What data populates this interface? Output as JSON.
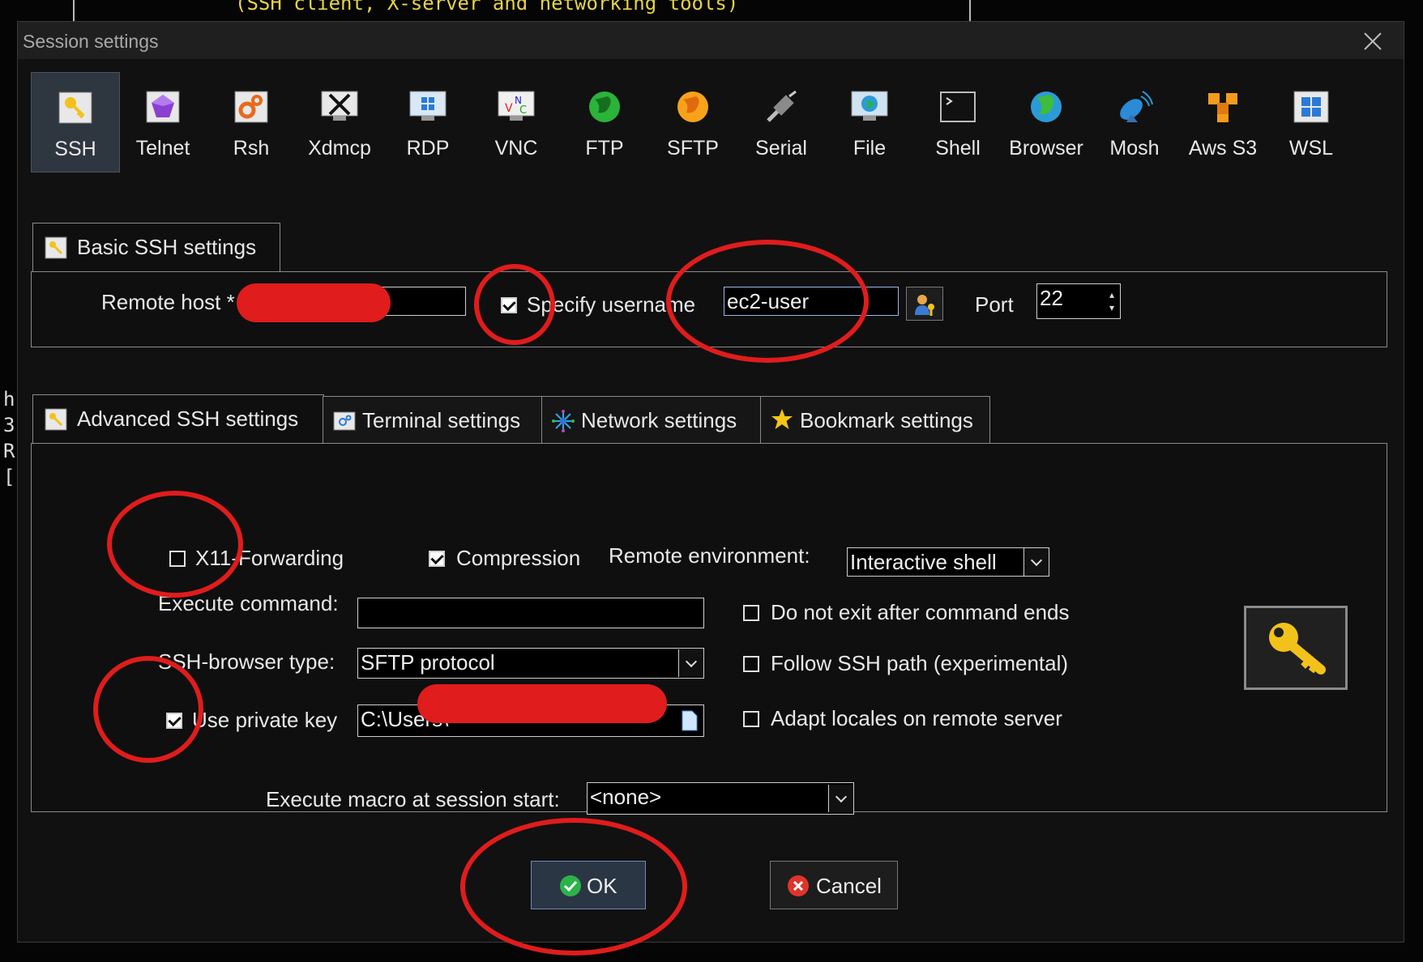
{
  "background": {
    "caption": "(SSH client, X-server and networking tools)",
    "left_chars": [
      "h",
      "3",
      "R",
      "["
    ]
  },
  "dialog": {
    "title": "Session settings"
  },
  "session_types": [
    {
      "label": "SSH",
      "icon": "key-icon",
      "active": true
    },
    {
      "label": "Telnet",
      "icon": "gem-icon"
    },
    {
      "label": "Rsh",
      "icon": "gears-icon"
    },
    {
      "label": "Xdmcp",
      "icon": "x-monitor-icon"
    },
    {
      "label": "RDP",
      "icon": "windows-monitor-icon"
    },
    {
      "label": "VNC",
      "icon": "vnc-monitor-icon"
    },
    {
      "label": "FTP",
      "icon": "green-globe-icon"
    },
    {
      "label": "SFTP",
      "icon": "orange-globe-icon"
    },
    {
      "label": "Serial",
      "icon": "serial-plug-icon"
    },
    {
      "label": "File",
      "icon": "file-monitor-icon"
    },
    {
      "label": "Shell",
      "icon": "terminal-icon"
    },
    {
      "label": "Browser",
      "icon": "globe-icon"
    },
    {
      "label": "Mosh",
      "icon": "satellite-dish-icon"
    },
    {
      "label": "Aws S3",
      "icon": "aws-cubes-icon"
    },
    {
      "label": "WSL",
      "icon": "windows-logo-icon"
    }
  ],
  "basic": {
    "tab_label": "Basic SSH settings",
    "remote_host_label": "Remote host *",
    "remote_host_value": "",
    "specify_username_label": "Specify username",
    "specify_username_checked": true,
    "username_value": "ec2-user",
    "port_label": "Port",
    "port_value": "22"
  },
  "tabs": [
    {
      "label": "Advanced SSH settings",
      "icon": "key-icon",
      "active": true
    },
    {
      "label": "Terminal settings",
      "icon": "terminal-gear-icon"
    },
    {
      "label": "Network settings",
      "icon": "network-star-icon"
    },
    {
      "label": "Bookmark settings",
      "icon": "star-icon"
    }
  ],
  "advanced": {
    "x11_label": "X11-Forwarding",
    "x11_checked": false,
    "compression_label": "Compression",
    "compression_checked": true,
    "remote_env_label": "Remote environment:",
    "remote_env_value": "Interactive shell",
    "execute_command_label": "Execute command:",
    "execute_command_value": "",
    "do_not_exit_label": "Do not exit after command ends",
    "browser_type_label": "SSH-browser type:",
    "browser_type_value": "SFTP protocol",
    "follow_path_label": "Follow SSH path (experimental)",
    "private_key_label": "Use private key",
    "private_key_checked": true,
    "private_key_value": "C:\\Users\\",
    "adapt_locales_label": "Adapt locales on remote server",
    "macro_label": "Execute macro at session start:",
    "macro_value": "<none>"
  },
  "buttons": {
    "ok": "OK",
    "cancel": "Cancel"
  },
  "colors": {
    "annotation_red": "#e01c1c",
    "accent_blue": "#6a8bb8"
  }
}
